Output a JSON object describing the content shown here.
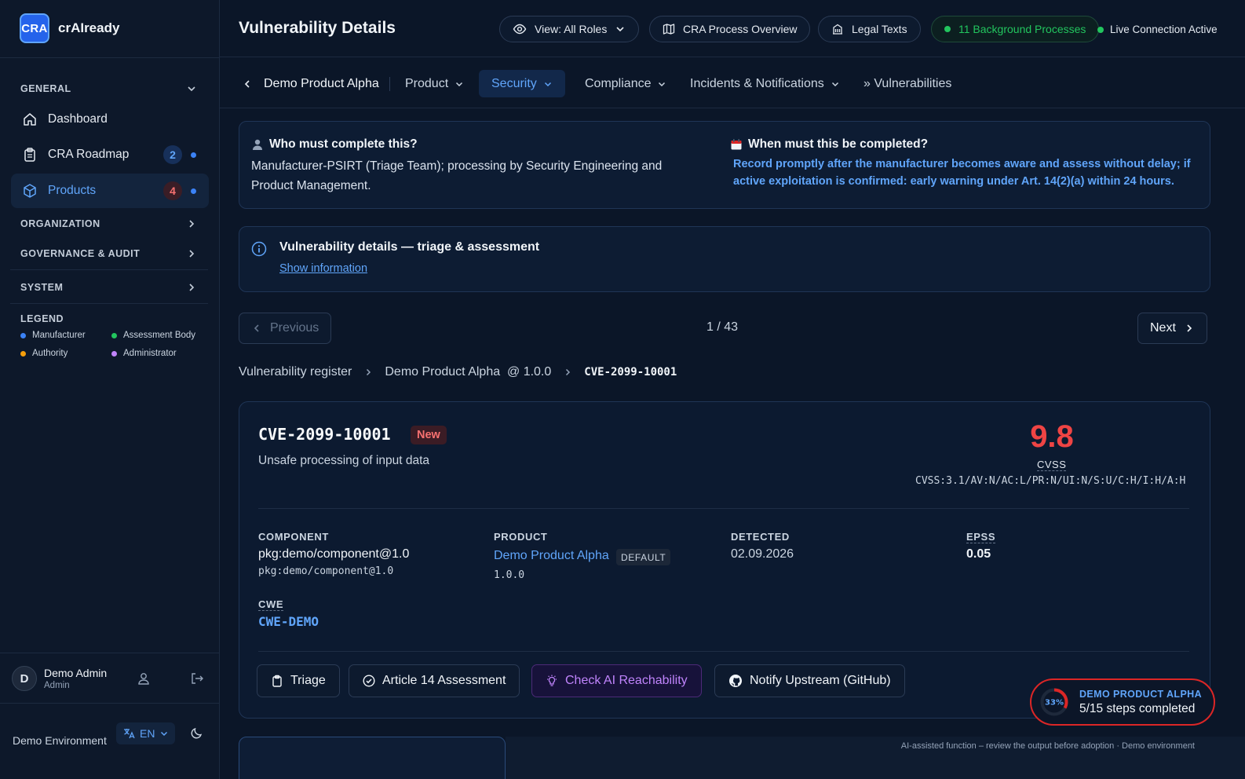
{
  "brand": {
    "logo": "CRA",
    "name": "crAIready"
  },
  "sidebar": {
    "general": "GENERAL",
    "items": [
      {
        "label": "Dashboard",
        "icon": "home-icon"
      },
      {
        "label": "CRA Roadmap",
        "icon": "clipboard-icon",
        "count": "2"
      },
      {
        "label": "Products",
        "icon": "box-icon",
        "count": "4",
        "active": true
      }
    ],
    "sections": [
      "ORGANIZATION",
      "GOVERNANCE & AUDIT",
      "SYSTEM"
    ],
    "legend": {
      "title": "LEGEND",
      "items": [
        {
          "label": "Manufacturer",
          "color": "#3b82f6"
        },
        {
          "label": "Assessment Body",
          "color": "#22c55e"
        },
        {
          "label": "Authority",
          "color": "#f59e0b"
        },
        {
          "label": "Administrator",
          "color": "#c084fc"
        }
      ]
    },
    "user": {
      "initial": "D",
      "name": "Demo Admin",
      "role": "Admin"
    },
    "env": "Demo Environment",
    "lang": "EN"
  },
  "header": {
    "title": "Vulnerability Details",
    "view_roles": "View: All Roles",
    "cra_overview": "CRA Process Overview",
    "legal_texts": "Legal Texts",
    "bg_processes": "11 Background Processes",
    "live": "Live Connection Active"
  },
  "subnav": {
    "product_name": "Demo Product Alpha",
    "tabs": [
      "Product",
      "Security",
      "Compliance",
      "Incidents & Notifications"
    ],
    "vulnerabilities": "» Vulnerabilities"
  },
  "who": {
    "title": "Who must complete this?",
    "text": "Manufacturer-PSIRT (Triage Team); processing by Security Engineering and Product Management."
  },
  "when": {
    "title": "When must this be completed?",
    "text": "Record promptly after the manufacturer becomes aware and assess without delay; if active exploitation is confirmed: early warning under Art. 14(2)(a) within 24 hours."
  },
  "details_info": {
    "title": "Vulnerability details — triage & assessment",
    "link": "Show information"
  },
  "pagination": {
    "previous": "Previous",
    "next": "Next",
    "current": "1",
    "total": "43"
  },
  "breadcrumb": {
    "register": "Vulnerability register",
    "product": "Demo Product Alpha",
    "version": "@ 1.0.0",
    "cve": "CVE-2099-10001"
  },
  "vuln": {
    "id": "CVE-2099-10001",
    "status": "New",
    "description": "Unsafe processing of input data",
    "cvss_score": "9.8",
    "cvss_label": "CVSS",
    "cvss_vector": "CVSS:3.1/AV:N/AC:L/PR:N/UI:N/S:U/C:H/I:H/A:H",
    "component_label": "COMPONENT",
    "component": "pkg:demo/component@1.0",
    "component_purl": "pkg:demo/component@1.0",
    "product_label": "PRODUCT",
    "product": "Demo Product Alpha",
    "product_tag": "DEFAULT",
    "product_version": "1.0.0",
    "detected_label": "DETECTED",
    "detected": "02.09.2026",
    "epss_label": "EPSS",
    "epss": "0.05",
    "cwe_label": "CWE",
    "cwe": "CWE-DEMO"
  },
  "actions": {
    "triage": "Triage",
    "art14": "Article 14 Assessment",
    "ai": "Check AI Reachability",
    "notify": "Notify Upstream (GitHub)"
  },
  "progress": {
    "percent_label": "33%",
    "percent": 33,
    "product": "DEMO PRODUCT ALPHA",
    "steps": "5/15 steps completed"
  },
  "ai_note": "AI-assisted function – review the output before adoption · Demo environment"
}
